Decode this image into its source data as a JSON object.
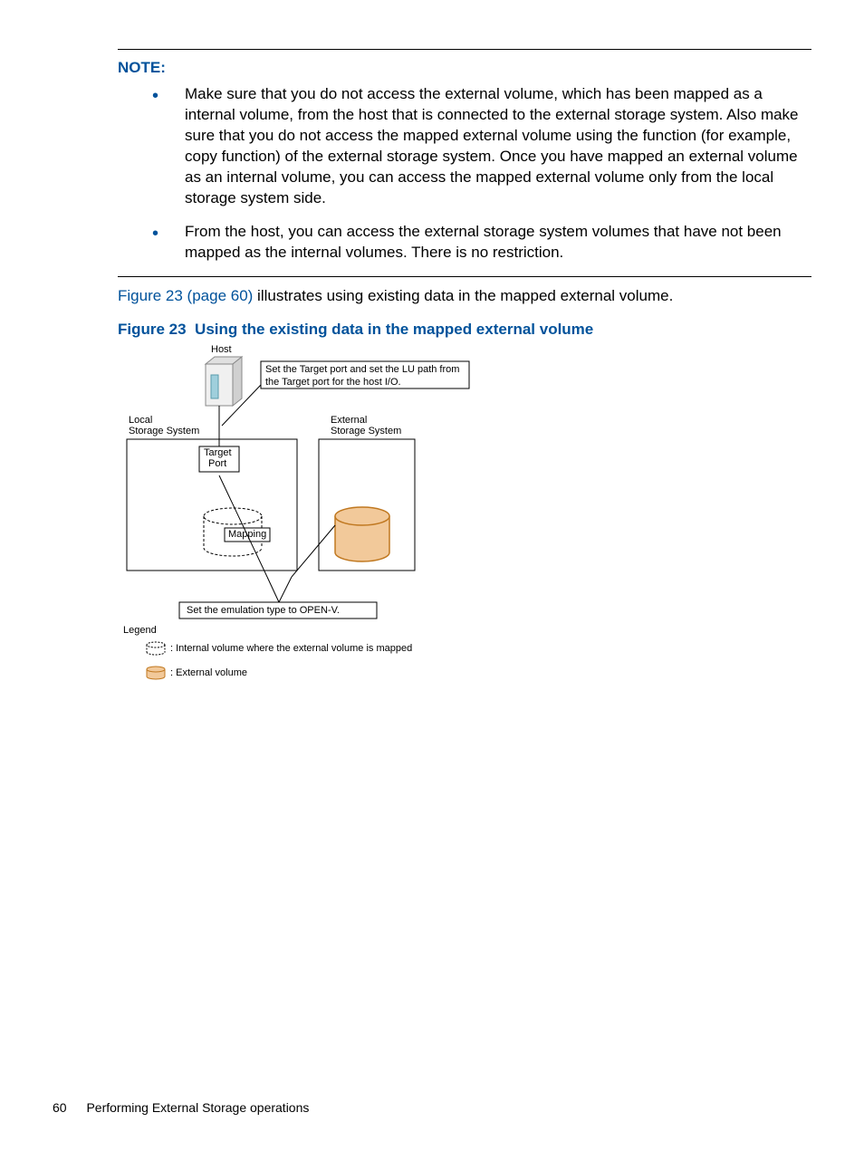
{
  "note": {
    "title": "NOTE:",
    "items": [
      "Make sure that you do not access the external volume, which has been mapped as a internal volume, from the host that is connected to the external storage system. Also make sure that you do not access the mapped external volume using the function (for example, copy function) of the external storage system. Once you have mapped an external volume as an internal volume, you can access the mapped external volume only from the local storage system side.",
      "From the host, you can access the external storage system volumes that have not been mapped as the internal volumes. There is no restriction."
    ]
  },
  "para": {
    "link": "Figure 23 (page 60)",
    "rest": " illustrates using existing data in the mapped external volume."
  },
  "figure": {
    "label": "Figure 23",
    "title": "Using the existing data in the mapped external volume"
  },
  "diagram": {
    "host": "Host",
    "callout1": "Set the Target port and set the LU path from the Target port for the host I/O.",
    "localSS_l1": "Local",
    "localSS_l2": "Storage System",
    "externalSS_l1": "External",
    "externalSS_l2": "Storage System",
    "targetPort_l1": "Target",
    "targetPort_l2": "Port",
    "mapping": "Mapping",
    "callout2": "Set the emulation type to OPEN-V.",
    "legend_title": "Legend",
    "legend_internal": ": Internal volume where the external volume is mapped",
    "legend_external": ": External volume"
  },
  "footer": {
    "page": "60",
    "section": "Performing External Storage operations"
  }
}
